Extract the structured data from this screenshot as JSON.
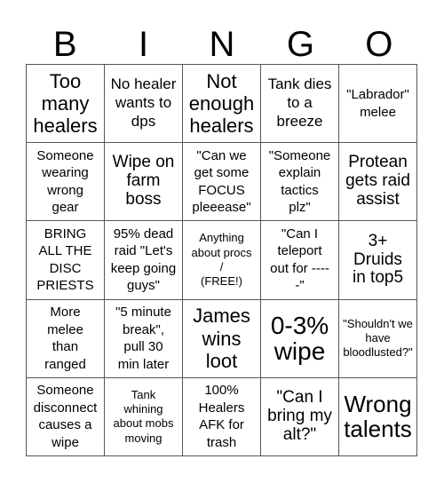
{
  "header": {
    "letters": [
      "B",
      "I",
      "N",
      "G",
      "O"
    ]
  },
  "cells": [
    {
      "text": "Too\nmany\nhealers",
      "size": "s22"
    },
    {
      "text": "No healer\nwants to\ndps",
      "size": "s17"
    },
    {
      "text": "Not\nenough\nhealers",
      "size": "s22"
    },
    {
      "text": "Tank dies\nto a\nbreeze",
      "size": "s17"
    },
    {
      "text": "\"Labrador\"\nmelee",
      "size": "s15"
    },
    {
      "text": "Someone\nwearing\nwrong\ngear",
      "size": "s15"
    },
    {
      "text": "Wipe on\nfarm\nboss",
      "size": "s19"
    },
    {
      "text": "\"Can we\nget some\nFOCUS\npleeease\"",
      "size": "s15"
    },
    {
      "text": "\"Someone\nexplain\ntactics\nplz\"",
      "size": "s15"
    },
    {
      "text": "Protean\ngets raid\nassist",
      "size": "s19"
    },
    {
      "text": "BRING\nALL THE\nDISC\nPRIESTS",
      "size": "s15"
    },
    {
      "text": "95% dead\nraid \"Let's\nkeep going\nguys\"",
      "size": "s15"
    },
    {
      "text": "Anything\nabout procs\n/\n(FREE!)",
      "size": "s13"
    },
    {
      "text": "\"Can I\nteleport\nout for ----\n-\"",
      "size": "s15"
    },
    {
      "text": "3+\nDruids\nin top5",
      "size": "s19"
    },
    {
      "text": "More\nmelee\nthan\nranged",
      "size": "s15"
    },
    {
      "text": "\"5 minute\nbreak\",\npull 30\nmin later",
      "size": "s15"
    },
    {
      "text": "James\nwins\nloot",
      "size": "s22"
    },
    {
      "text": "0-3%\nwipe",
      "size": "s30"
    },
    {
      "text": "\"Shouldn't we\nhave\nbloodlusted?\"",
      "size": "s13"
    },
    {
      "text": "Someone\ndisconnect\ncauses a\nwipe",
      "size": "s15"
    },
    {
      "text": "Tank\nwhining\nabout mobs\nmoving",
      "size": "s13"
    },
    {
      "text": "100%\nHealers\nAFK for\ntrash",
      "size": "s15"
    },
    {
      "text": "\"Can I\nbring my\nalt?\"",
      "size": "s19"
    },
    {
      "text": "Wrong\ntalents",
      "size": "s26"
    }
  ]
}
